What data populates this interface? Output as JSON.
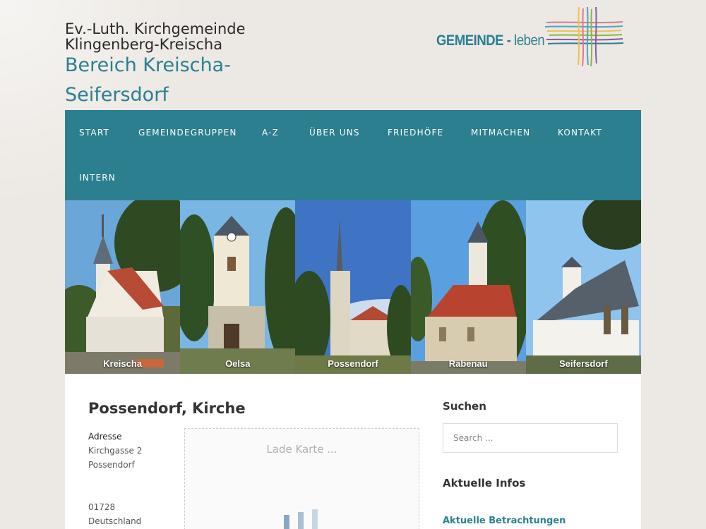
{
  "header": {
    "org_line1": "Ev.-Luth. Kirchgemeinde",
    "org_line2": "Klingenberg-Kreischa",
    "site_title": "Bereich Kreischa-Seifersdorf",
    "logo_text_main": "GEMEINDE",
    "logo_text_sep": " - ",
    "logo_text_sub": "leben"
  },
  "nav": {
    "items": [
      {
        "label": "START"
      },
      {
        "label": "GEMEINDEGRUPPEN"
      },
      {
        "label": "A-Z"
      },
      {
        "label": "ÜBER UNS"
      },
      {
        "label": "FRIEDHÖFE"
      },
      {
        "label": "MITMACHEN"
      },
      {
        "label": "KONTAKT"
      },
      {
        "label": "INTERN"
      }
    ]
  },
  "banner": {
    "panels": [
      {
        "caption": "Kreischa"
      },
      {
        "caption": "Oelsa"
      },
      {
        "caption": "Possendorf"
      },
      {
        "caption": "Rabenau"
      },
      {
        "caption": "Seifersdorf"
      }
    ]
  },
  "main": {
    "title": "Possendorf, Kirche",
    "address_label": "Adresse",
    "address_lines": [
      "Kirchgasse 2",
      "Possendorf",
      "",
      "",
      "01728",
      "Deutschland"
    ],
    "map_loading": "Lade Karte ..."
  },
  "sidebar": {
    "search_heading": "Suchen",
    "search_placeholder": "Search ...",
    "infos_heading": "Aktuelle Infos",
    "infos_link": "Aktuelle Betrachtungen"
  },
  "colors": {
    "accent": "#2b7f8f",
    "title_teal": "#2a7f92",
    "page_bg": "#ece8e3"
  }
}
